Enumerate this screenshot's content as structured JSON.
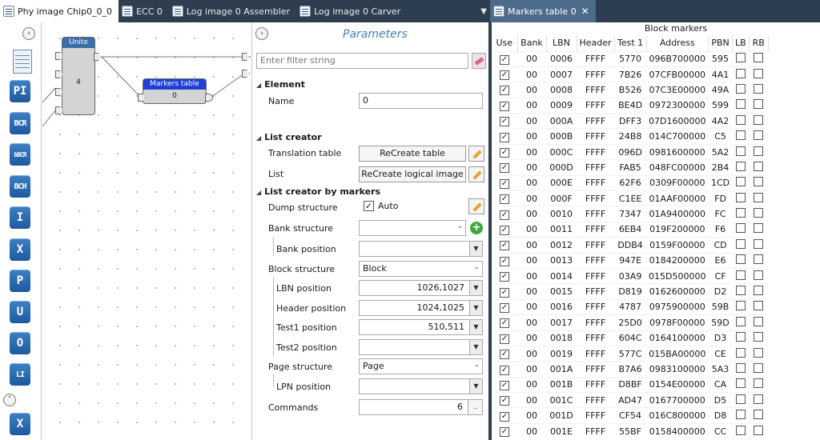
{
  "tabs_left": [
    {
      "label": "Phy image Chip0_0_0",
      "icon": "document-icon"
    },
    {
      "label": "ECC 0",
      "icon": "document-icon"
    },
    {
      "label": "Log image 0 Assembler",
      "icon": "document-icon"
    },
    {
      "label": "Log image 0 Carver",
      "icon": "document-icon"
    }
  ],
  "tab_right": {
    "label": "Markers table 0",
    "close": "✕"
  },
  "tools": [
    "PI",
    "BCR",
    "bBCR",
    "BCH",
    "I",
    "X",
    "P",
    "U",
    "O",
    "LI",
    "X"
  ],
  "canvas": {
    "unite": {
      "title": "Unite",
      "value": "4"
    },
    "markers_node": {
      "title": "Markers table",
      "value": "0"
    }
  },
  "params": {
    "title": "Parameters",
    "filter_placeholder": "Enter filter string",
    "element": {
      "header": "Element",
      "name_label": "Name",
      "name_value": "0"
    },
    "list_creator": {
      "header": "List creator",
      "translation_label": "Translation table",
      "translation_btn": "ReCreate table",
      "list_label": "List",
      "list_btn": "ReCreate logical image"
    },
    "by_markers": {
      "header": "List creator by markers",
      "dump_label": "Dump structure",
      "dump_check_label": "Auto",
      "bank_structure_label": "Bank structure",
      "bank_structure_value": "",
      "bank_position_label": "Bank position",
      "bank_position_value": "",
      "block_structure_label": "Block structure",
      "block_structure_value": "Block",
      "lbn_position_label": "LBN position",
      "lbn_position_value": "1026,1027",
      "header_position_label": "Header position",
      "header_position_value": "1024,1025",
      "test1_position_label": "Test1 position",
      "test1_position_value": "510,511",
      "test2_position_label": "Test2 position",
      "test2_position_value": "",
      "page_structure_label": "Page structure",
      "page_structure_value": "Page",
      "lpn_position_label": "LPN position",
      "lpn_position_value": "",
      "commands_label": "Commands",
      "commands_value": "6",
      "commands_btn": ".."
    }
  },
  "markers_table": {
    "title": "Block markers",
    "columns": [
      "Use",
      "Bank",
      "LBN",
      "Header",
      "Test 1",
      "Address",
      "PBN",
      "LB",
      "RB"
    ],
    "rows": [
      [
        "00",
        "0006",
        "FFFF",
        "5770",
        "096B700000",
        "595"
      ],
      [
        "00",
        "0007",
        "FFFF",
        "7B26",
        "07CFB00000",
        "4A1"
      ],
      [
        "00",
        "0008",
        "FFFF",
        "B526",
        "07C3E00000",
        "49A"
      ],
      [
        "00",
        "0009",
        "FFFF",
        "BE4D",
        "0972300000",
        "599"
      ],
      [
        "00",
        "000A",
        "FFFF",
        "DFF3",
        "07D1600000",
        "4A2"
      ],
      [
        "00",
        "000B",
        "FFFF",
        "24B8",
        "014C700000",
        "C5"
      ],
      [
        "00",
        "000C",
        "FFFF",
        "096D",
        "0981600000",
        "5A2"
      ],
      [
        "00",
        "000D",
        "FFFF",
        "FAB5",
        "048FC00000",
        "2B4"
      ],
      [
        "00",
        "000E",
        "FFFF",
        "62F6",
        "0309F00000",
        "1CD"
      ],
      [
        "00",
        "000F",
        "FFFF",
        "C1EE",
        "01AAF00000",
        "FD"
      ],
      [
        "00",
        "0010",
        "FFFF",
        "7347",
        "01A9400000",
        "FC"
      ],
      [
        "00",
        "0011",
        "FFFF",
        "6EB4",
        "019F200000",
        "F6"
      ],
      [
        "00",
        "0012",
        "FFFF",
        "DDB4",
        "0159F00000",
        "CD"
      ],
      [
        "00",
        "0013",
        "FFFF",
        "947E",
        "0184200000",
        "E6"
      ],
      [
        "00",
        "0014",
        "FFFF",
        "03A9",
        "015D500000",
        "CF"
      ],
      [
        "00",
        "0015",
        "FFFF",
        "D819",
        "0162600000",
        "D2"
      ],
      [
        "00",
        "0016",
        "FFFF",
        "4787",
        "0975900000",
        "59B"
      ],
      [
        "00",
        "0017",
        "FFFF",
        "25D0",
        "0978F00000",
        "59D"
      ],
      [
        "00",
        "0018",
        "FFFF",
        "604C",
        "0164100000",
        "D3"
      ],
      [
        "00",
        "0019",
        "FFFF",
        "577C",
        "015BA00000",
        "CE"
      ],
      [
        "00",
        "001A",
        "FFFF",
        "B7A6",
        "0983100000",
        "5A3"
      ],
      [
        "00",
        "001B",
        "FFFF",
        "D8BF",
        "0154E00000",
        "CA"
      ],
      [
        "00",
        "001C",
        "FFFF",
        "AD47",
        "0167700000",
        "D5"
      ],
      [
        "00",
        "001D",
        "FFFF",
        "CF54",
        "016C800000",
        "D8"
      ],
      [
        "00",
        "001E",
        "FFFF",
        "55BF",
        "0158400000",
        "CC"
      ]
    ]
  }
}
